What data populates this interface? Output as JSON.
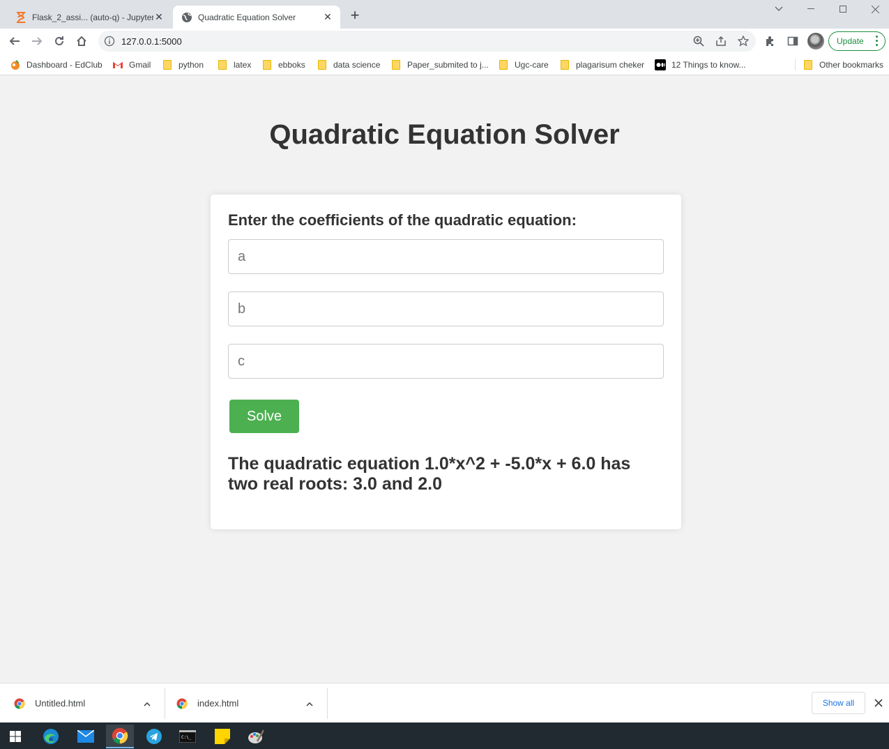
{
  "browser": {
    "tabs": [
      {
        "title": "Flask_2_assi... (auto-q) - JupyterL",
        "icon": "jupyter-hourglass-icon",
        "active": false
      },
      {
        "title": "Quadratic Equation Solver",
        "icon": "globe-icon",
        "active": true
      }
    ],
    "url": "127.0.0.1:5000",
    "update_label": "Update",
    "bookmarks": [
      {
        "label": "Dashboard - EdClub",
        "icon": "edclub-icon"
      },
      {
        "label": "Gmail",
        "icon": "gmail-icon"
      },
      {
        "label": "python",
        "icon": "folder-icon"
      },
      {
        "label": "latex",
        "icon": "folder-icon"
      },
      {
        "label": "ebboks",
        "icon": "folder-icon"
      },
      {
        "label": "data science",
        "icon": "folder-icon"
      },
      {
        "label": "Paper_submited to j...",
        "icon": "folder-icon"
      },
      {
        "label": "Ugc-care",
        "icon": "folder-icon"
      },
      {
        "label": "plagarisum cheker",
        "icon": "folder-icon"
      },
      {
        "label": "12 Things to know...",
        "icon": "medium-icon"
      }
    ],
    "other_bookmarks": "Other bookmarks"
  },
  "page": {
    "title": "Quadratic Equation Solver",
    "form": {
      "heading": "Enter the coefficients of the quadratic equation:",
      "fields": [
        {
          "placeholder": "a",
          "value": ""
        },
        {
          "placeholder": "b",
          "value": ""
        },
        {
          "placeholder": "c",
          "value": ""
        }
      ],
      "submit_label": "Solve"
    },
    "result": "The quadratic equation 1.0*x^2 + -5.0*x + 6.0 has two real roots: 3.0 and 2.0"
  },
  "downloads": {
    "items": [
      {
        "name": "Untitled.html",
        "icon": "chrome-icon"
      },
      {
        "name": "index.html",
        "icon": "chrome-icon"
      }
    ],
    "show_all_label": "Show all"
  },
  "taskbar": {
    "apps": [
      "windows-start-icon",
      "edge-icon",
      "mail-icon",
      "chrome-icon",
      "telegram-icon",
      "terminal-icon",
      "sticky-notes-icon",
      "paint-icon"
    ]
  },
  "colors": {
    "primary_button": "#4caf50",
    "text": "#333333",
    "page_background": "#f2f2f2"
  }
}
